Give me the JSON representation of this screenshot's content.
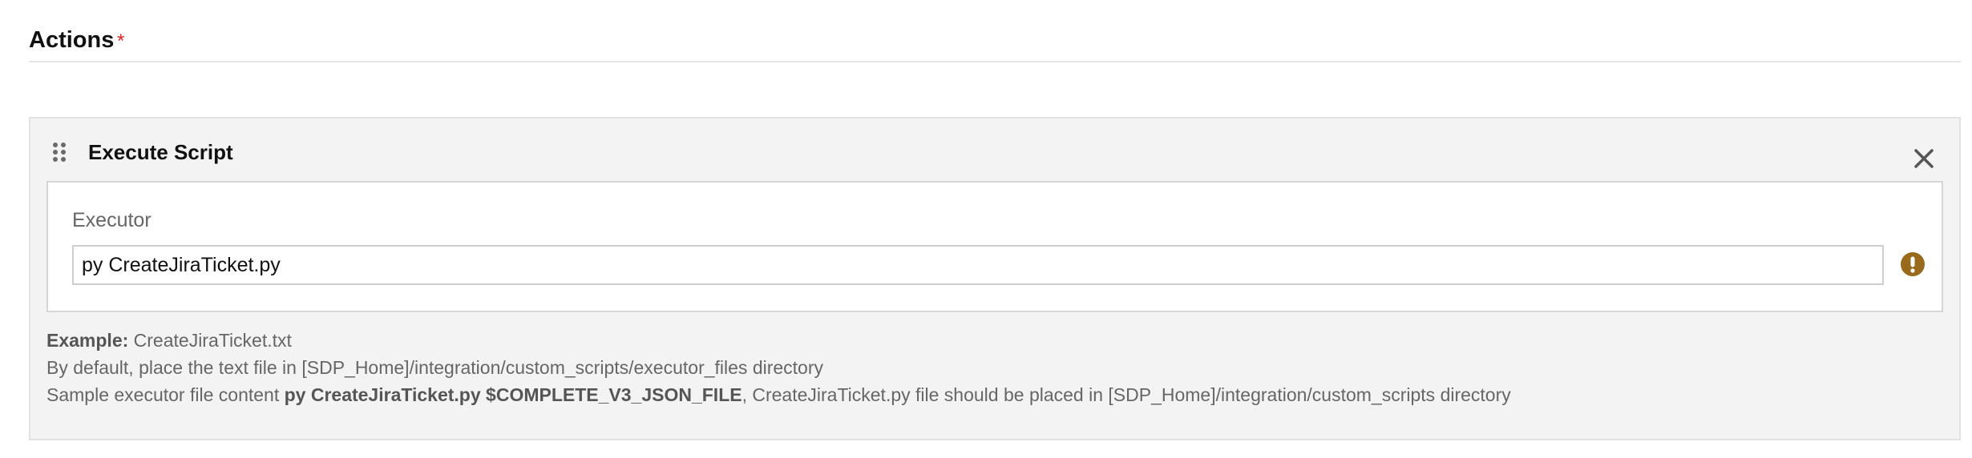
{
  "section": {
    "title": "Actions",
    "required_marker": "*"
  },
  "action_card": {
    "title": "Execute Script",
    "drag_icon": "drag-handle-icon",
    "close_icon": "close-icon",
    "executor": {
      "label": "Executor",
      "value": "py CreateJiraTicket.py",
      "warning_icon": "exclamation-circle-icon",
      "warning_color": "#9a6a1c"
    },
    "help": {
      "example_label": "Example:",
      "example_value": "CreateJiraTicket.txt",
      "default_location": "By default, place the text file in [SDP_Home]/integration/custom_scripts/executor_files directory",
      "sample_prefix": "Sample executor file content",
      "sample_command": "py CreateJiraTicket.py $COMPLETE_V3_JSON_FILE",
      "sample_suffix": ", CreateJiraTicket.py file should be placed in [SDP_Home]/integration/custom_scripts directory"
    }
  },
  "colors": {
    "required_star": "#e02020",
    "card_background": "#f3f3f3",
    "text_muted": "#666666"
  }
}
